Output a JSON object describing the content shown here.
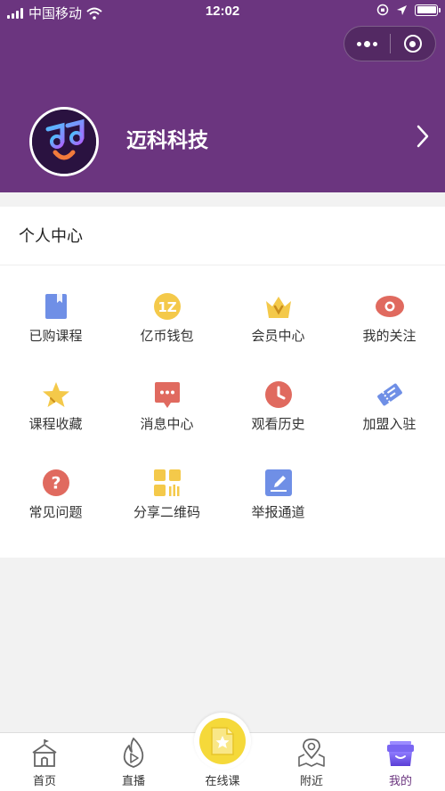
{
  "status_bar": {
    "carrier": "中国移动",
    "time": "12:02"
  },
  "profile": {
    "name": "迈科科技"
  },
  "panel": {
    "title": "个人中心",
    "items": [
      {
        "label": "已购课程",
        "icon": "book-icon",
        "color": "#6f8fe6"
      },
      {
        "label": "亿币钱包",
        "icon": "coin-icon",
        "color": "#f4c94a"
      },
      {
        "label": "会员中心",
        "icon": "crown-icon",
        "color": "#f4c94a"
      },
      {
        "label": "我的关注",
        "icon": "eye-icon",
        "color": "#e06a5f"
      },
      {
        "label": "课程收藏",
        "icon": "star-icon",
        "color": "#f4c94a"
      },
      {
        "label": "消息中心",
        "icon": "message-icon",
        "color": "#e06a5f"
      },
      {
        "label": "观看历史",
        "icon": "clock-icon",
        "color": "#e06a5f"
      },
      {
        "label": "加盟入驻",
        "icon": "ticket-icon",
        "color": "#6f8fe6"
      },
      {
        "label": "常见问题",
        "icon": "question-icon",
        "color": "#e06a5f"
      },
      {
        "label": "分享二维码",
        "icon": "qrcode-icon",
        "color": "#f4c94a"
      },
      {
        "label": "举报通道",
        "icon": "report-icon",
        "color": "#6f8fe6"
      }
    ]
  },
  "tabbar": {
    "tabs": [
      {
        "label": "首页",
        "icon": "home-icon"
      },
      {
        "label": "直播",
        "icon": "live-flame-icon"
      },
      {
        "label": "在线课",
        "icon": "online-course-icon"
      },
      {
        "label": "附近",
        "icon": "map-pin-icon"
      },
      {
        "label": "我的",
        "icon": "profile-box-icon",
        "active": true
      }
    ]
  },
  "colors": {
    "header_bg": "#6b357f",
    "accent_yellow": "#f5d93a",
    "active_tab": "#6b357f"
  }
}
